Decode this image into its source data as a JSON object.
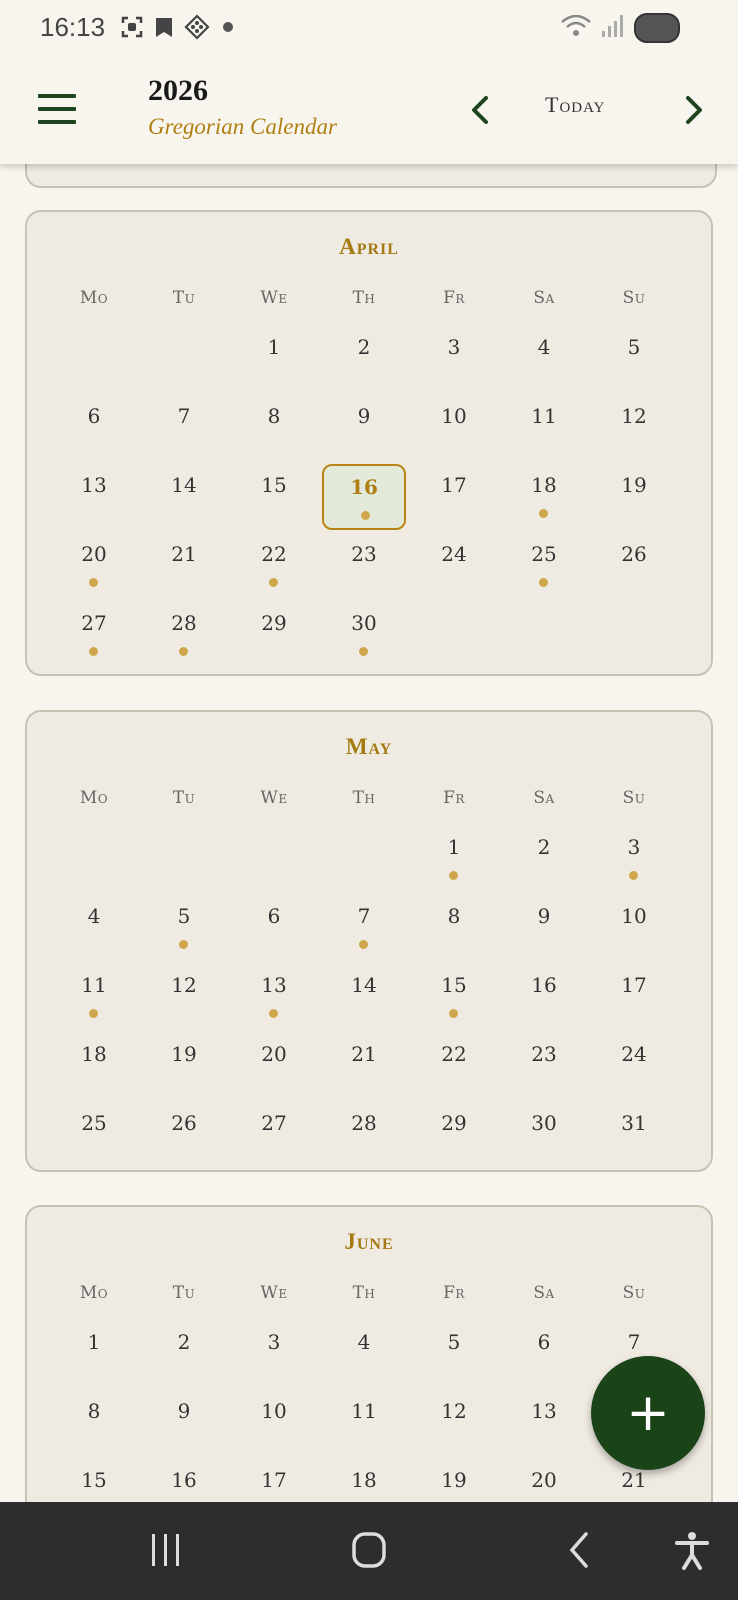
{
  "status_bar": {
    "time": "16:13",
    "icons": [
      "screenshot-icon",
      "bookmark-icon",
      "app-icon",
      "dot-icon",
      "wifi-icon",
      "signal-icon",
      "battery-icon"
    ],
    "wifi_badge": "5"
  },
  "app_bar": {
    "title": "2026",
    "subtitle": "Gregorian Calendar",
    "today_label": "Today"
  },
  "weekdays": [
    "Mo",
    "Tu",
    "We",
    "Th",
    "Fr",
    "Sa",
    "Su"
  ],
  "months": [
    {
      "name": "April",
      "first_weekday_index": 2,
      "days_visible": 30,
      "today": 16,
      "event_days": [
        16,
        18,
        20,
        22,
        25,
        27,
        28,
        30
      ]
    },
    {
      "name": "May",
      "first_weekday_index": 4,
      "days_visible": 31,
      "today": null,
      "event_days": [
        1,
        3,
        5,
        7,
        11,
        13,
        15
      ]
    },
    {
      "name": "June",
      "first_weekday_index": 0,
      "days_visible": 21,
      "today": null,
      "event_days": []
    }
  ],
  "fab": {
    "label": "+"
  },
  "colors": {
    "accent": "#1b4318",
    "gold": "#b07f12",
    "dot": "#cfa64b",
    "card": "#f0ebe2"
  }
}
